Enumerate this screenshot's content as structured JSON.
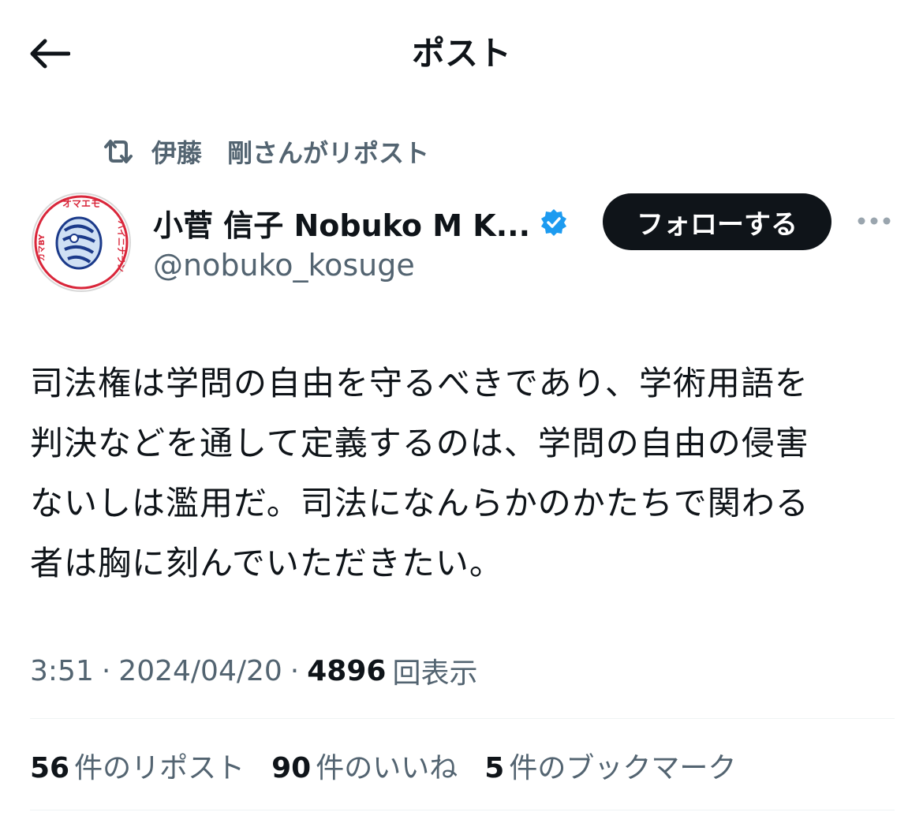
{
  "header": {
    "title": "ポスト",
    "back_icon": "arrow-left-icon"
  },
  "repost": {
    "icon": "repost-icon",
    "text": "伊藤　剛さんがリポスト"
  },
  "author": {
    "display_name": "小菅 信子 Nobuko M K...",
    "handle": "@nobuko_kosuge",
    "verified": true,
    "verified_color": "#1d9bf0",
    "avatar_text": "オマエモハイニナラン"
  },
  "actions": {
    "follow_label": "フォローする",
    "more_icon": "more-horizontal-icon"
  },
  "post": {
    "text": "司法権は学問の自由を守るべきであり、学術用語を\n判決などを通して定義するのは、学問の自由の侵害\nないしは濫用だ。司法になんらかのかたちで関わる\n者は胸に刻んでいただきたい。"
  },
  "meta": {
    "time": "3:51",
    "date": "2024/04/20",
    "views_count": "4896",
    "views_label": "回表示",
    "separator": "·"
  },
  "stats": [
    {
      "count": "56",
      "label": "件のリポスト"
    },
    {
      "count": "90",
      "label": "件のいいね"
    },
    {
      "count": "5",
      "label": "件のブックマーク"
    }
  ],
  "colors": {
    "text": "#0f1419",
    "secondary": "#536471",
    "accent": "#1d9bf0",
    "divider": "#eff3f4",
    "button_bg": "#0f1419"
  }
}
